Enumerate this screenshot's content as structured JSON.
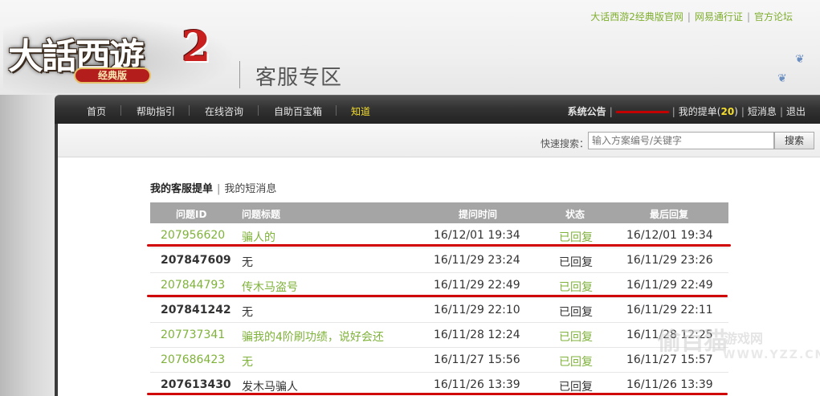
{
  "top_links": [
    "大话西游2经典版官网",
    "网易通行证",
    "官方论坛"
  ],
  "logo": {
    "main": "大話西遊",
    "number": "2",
    "sub": "经典版"
  },
  "section_title": "客服专区",
  "nav": {
    "items": [
      "首页",
      "帮助指引",
      "在线咨询",
      "自助百宝箱",
      "知道"
    ],
    "active_index": 4,
    "announcement": "系统公告",
    "my_tickets_label": "我的提单",
    "my_tickets_count": "20",
    "messages": "短消息",
    "logout": "退出"
  },
  "search": {
    "label": "快速搜索：",
    "placeholder": "输入方案编号/关键字",
    "button": "搜索"
  },
  "tabs": {
    "active": "我的客服提单",
    "other": "我的短消息"
  },
  "table": {
    "headers": [
      "问题ID",
      "问题标题",
      "提问时间",
      "状态",
      "最后回复"
    ],
    "rows": [
      {
        "id": "207956620",
        "title": "骗人的",
        "time": "16/12/01 19:34",
        "status": "已回复",
        "last": "16/12/01 19:34",
        "style": "green"
      },
      {
        "id": "207847609",
        "title": "无",
        "time": "16/11/29 23:24",
        "status": "已回复",
        "last": "16/11/29 23:26",
        "style": "dark"
      },
      {
        "id": "207844793",
        "title": "传木马盗号",
        "time": "16/11/29 22:49",
        "status": "已回复",
        "last": "16/11/29 22:49",
        "style": "green"
      },
      {
        "id": "207841242",
        "title": "无",
        "time": "16/11/29 22:10",
        "status": "已回复",
        "last": "16/11/29 22:11",
        "style": "dark"
      },
      {
        "id": "207737341",
        "title": "骗我的4阶刷功绩，说好会还",
        "time": "16/11/28 12:24",
        "status": "已回复",
        "last": "16/11/28 12:25",
        "style": "green"
      },
      {
        "id": "207686423",
        "title": "无",
        "time": "16/11/27 15:56",
        "status": "已回复",
        "last": "16/11/27 15:57",
        "style": "green"
      },
      {
        "id": "207613430",
        "title": "发木马骗人",
        "time": "16/11/26 13:39",
        "status": "已回复",
        "last": "16/11/26 13:39",
        "style": "dark"
      }
    ]
  },
  "watermark": {
    "brand": "游戏网",
    "url": "WWW.YZZ.CN"
  },
  "colors": {
    "green_link": "#7fb23a",
    "nav_active": "#f3dc2e",
    "highlight_red": "#d10000",
    "header_gray": "#a5a5a5"
  }
}
